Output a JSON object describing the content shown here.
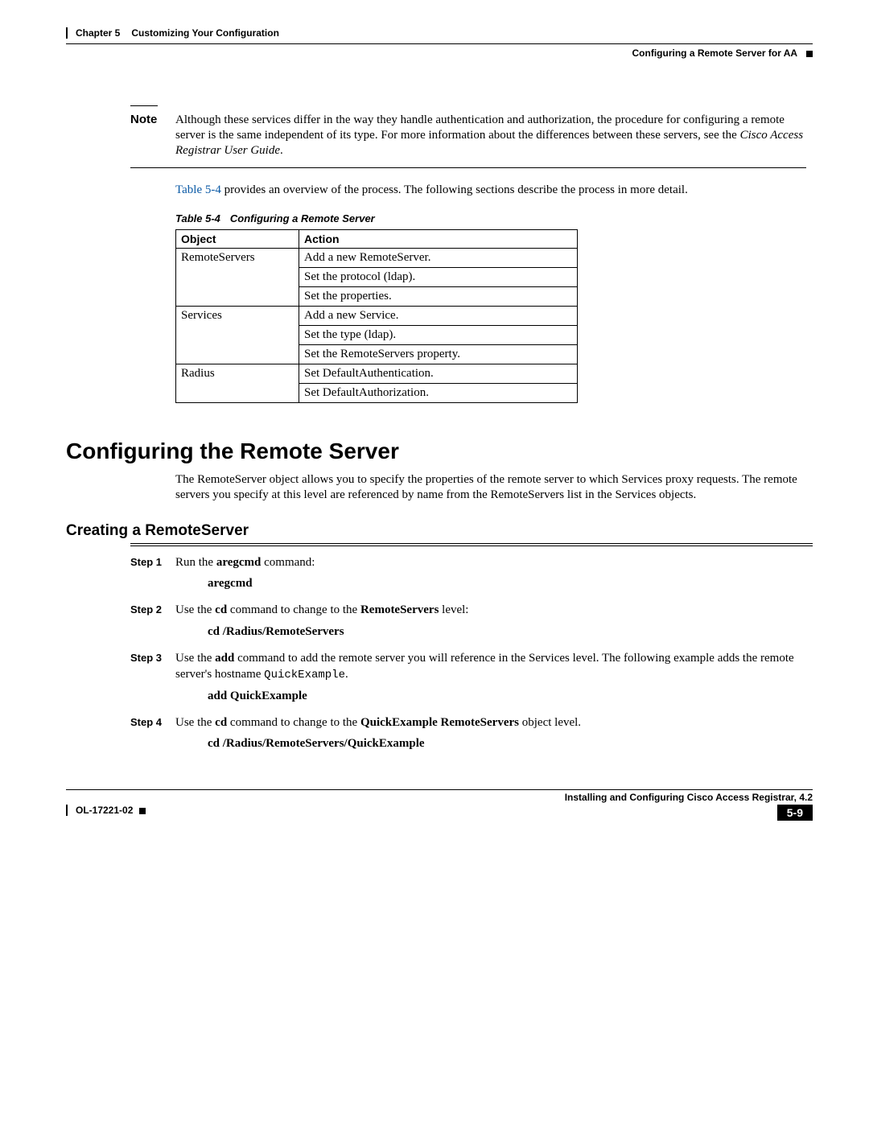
{
  "header": {
    "chapter_label": "Chapter 5",
    "chapter_title": "Customizing Your Configuration",
    "section_right": "Configuring a Remote Server for AA"
  },
  "note": {
    "label": "Note",
    "text": "Although these services differ in the way they handle authentication and authorization, the procedure for configuring a remote server is the same independent of its type. For more information about the differences between these servers, see the ",
    "ref": "Cisco Access Registrar User Guide"
  },
  "intro": {
    "link": "Table 5-4",
    "rest": " provides an overview of the process. The following sections describe the process in more detail."
  },
  "table_caption": {
    "num": "Table 5-4",
    "title": "Configuring a Remote Server"
  },
  "table": {
    "head_object": "Object",
    "head_action": "Action",
    "r1_obj": "RemoteServers",
    "r1_a": "Add a new RemoteServer.",
    "r1_b": "Set the protocol (ldap).",
    "r1_c": "Set the properties.",
    "r2_obj": "Services",
    "r2_a": "Add a new Service.",
    "r2_b": "Set the type (ldap).",
    "r2_c": "Set the RemoteServers property.",
    "r3_obj": "Radius",
    "r3_a": "Set DefaultAuthentication.",
    "r3_b": "Set DefaultAuthorization."
  },
  "h1": "Configuring the Remote Server",
  "section_intro": "The RemoteServer object allows you to specify the properties of the remote server to which Services proxy requests. The remote servers you specify at this level are referenced by name from the RemoteServers list in the Services objects.",
  "h2": "Creating a RemoteServer",
  "steps": {
    "s1_label": "Step 1",
    "s1_a": "Run the ",
    "s1_b": "aregcmd",
    "s1_c": " command:",
    "s1_cmd": "aregcmd",
    "s2_label": "Step 2",
    "s2_a": "Use the ",
    "s2_b": "cd",
    "s2_c": " command to change to the ",
    "s2_d": "RemoteServers",
    "s2_e": " level:",
    "s2_cmd": "cd /Radius/RemoteServers",
    "s3_label": "Step 3",
    "s3_a": "Use the ",
    "s3_b": "add",
    "s3_c": " command to add the remote server you will reference in the Services level. The following example adds the remote server's hostname ",
    "s3_d": "QuickExample",
    "s3_e": ".",
    "s3_cmd": "add QuickExample",
    "s4_label": "Step 4",
    "s4_a": "Use the ",
    "s4_b": "cd",
    "s4_c": " command to change to the ",
    "s4_d": "QuickExample RemoteServers",
    "s4_e": " object level.",
    "s4_cmd": "cd /Radius/RemoteServers/QuickExample"
  },
  "footer": {
    "book_title": "Installing and Configuring Cisco Access Registrar, 4.2",
    "doc_id": "OL-17221-02",
    "page": "5-9"
  }
}
